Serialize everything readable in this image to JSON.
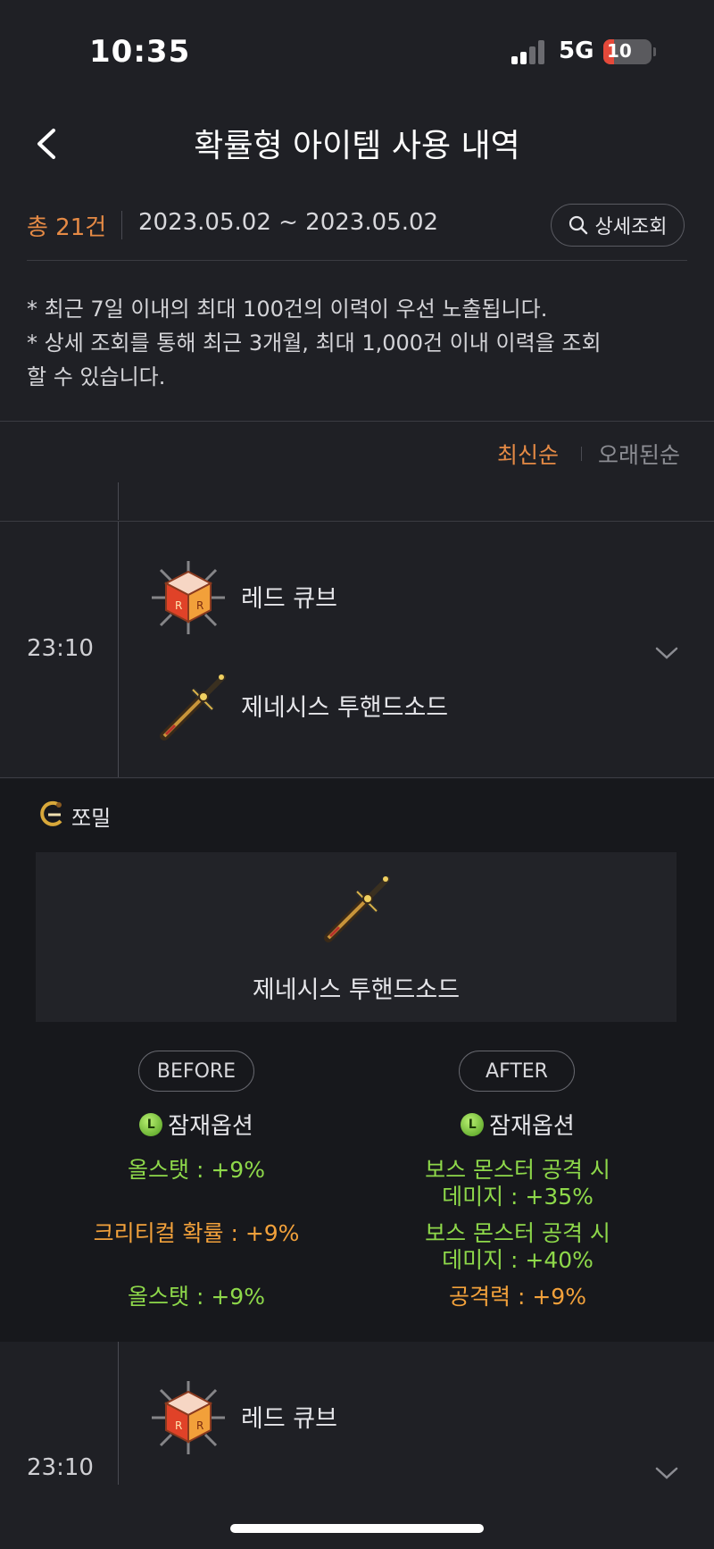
{
  "status_bar": {
    "time": "10:35",
    "network": "5G",
    "battery": "10"
  },
  "header": {
    "title": "확률형 아이템 사용 내역",
    "back_icon": "chevron-left-icon"
  },
  "summary": {
    "count": "총 21건",
    "date_range": "2023.05.02 ~ 2023.05.02",
    "detail_button": "상세조회"
  },
  "notes": [
    "* 최근 7일 이내의 최대 100건의 이력이 우선 노출됩니다.",
    "* 상세 조회를 통해 최근 3개월, 최대 1,000건 이내 이력을 조회",
    "할 수 있습니다."
  ],
  "sort": {
    "newest": "최신순",
    "oldest": "오래된순"
  },
  "entries": [
    {
      "time": "23:10",
      "used_item": "레드 큐브",
      "target_item": "제네시스 투핸드소드",
      "expanded": true,
      "character": "쪼밀",
      "detail_item": "제네시스 투핸드소드",
      "before_label": "BEFORE",
      "after_label": "AFTER",
      "option_title": "잠재옵션",
      "grade_letter": "L",
      "before_options": [
        "올스탯 : +9%",
        "크리티컬 확률 : +9%",
        "올스탯 : +9%"
      ],
      "after_options": [
        {
          "line1": "보스 몬스터 공격 시",
          "line2": "데미지 : +35%"
        },
        {
          "line1": "보스 몬스터 공격 시",
          "line2": "데미지 : +40%"
        },
        {
          "line1": "공격력 : +9%",
          "line2": ""
        }
      ]
    },
    {
      "time": "23:10",
      "used_item": "레드 큐브"
    }
  ],
  "colors": {
    "accent": "#e58a45",
    "option_green": "#8ed84a",
    "option_orange": "#f2a13b",
    "background": "#1f2025"
  }
}
